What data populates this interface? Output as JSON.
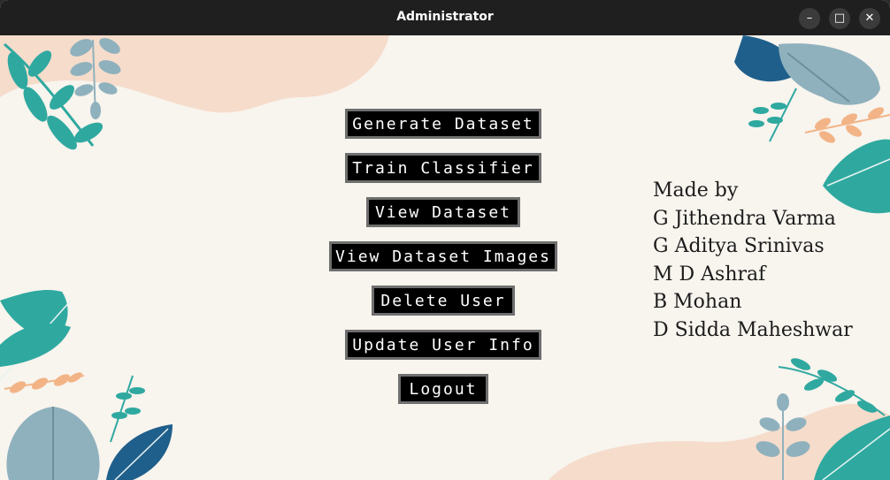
{
  "window": {
    "title": "Administrator",
    "controls": {
      "minimize": "–",
      "maximize": "□",
      "close": "✕"
    }
  },
  "menu": {
    "buttons": [
      {
        "label": "Generate Dataset"
      },
      {
        "label": "Train Classifier"
      },
      {
        "label": "View Dataset"
      },
      {
        "label": "View Dataset Images"
      },
      {
        "label": "Delete User"
      },
      {
        "label": "Update User Info"
      },
      {
        "label": "Logout"
      }
    ]
  },
  "credits": {
    "heading": "Made by",
    "names": [
      "G Jithendra Varma",
      "G Aditya Srinivas",
      "M D Ashraf",
      "B Mohan",
      "D Sidda Maheshwar"
    ]
  },
  "colors": {
    "background": "#f8f4ee",
    "blob": "#f6dccb",
    "teal": "#2fa9a0",
    "navy": "#1f5f8b",
    "gray_blue": "#8fb1bd",
    "orange": "#f2b486",
    "button_bg": "#000000",
    "button_border": "#6f6f6f"
  },
  "decor": {
    "icons": [
      "leaf-cluster-top-left",
      "leaf-cluster-top-right",
      "leaf-cluster-bottom-left",
      "leaf-cluster-bottom-right"
    ]
  }
}
